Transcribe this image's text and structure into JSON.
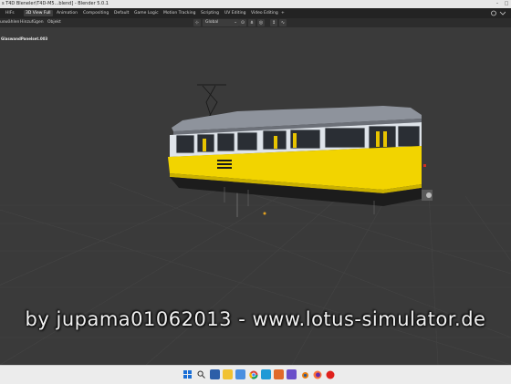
{
  "title_bar": {
    "title": "s T4D Bleneler\\T4D-M5...blend] - Blender 5.0.1",
    "window_controls": [
      "minimize-icon",
      "maximize-icon"
    ]
  },
  "workspace_tabs": [
    {
      "label": "HIFs",
      "active": false
    },
    {
      "label": "3D View Full",
      "active": true
    },
    {
      "label": "Animation",
      "active": false
    },
    {
      "label": "Compositing",
      "active": false
    },
    {
      "label": "Default",
      "active": false
    },
    {
      "label": "Game Logic",
      "active": false
    },
    {
      "label": "Motion Tracking",
      "active": false
    },
    {
      "label": "Scripting",
      "active": false
    },
    {
      "label": "UV Editing",
      "active": false
    },
    {
      "label": "Video Editing",
      "active": false
    },
    {
      "label": "+",
      "active": false
    }
  ],
  "viewport_header": {
    "menus": [
      "uswählen",
      "Hinzufügen",
      "Objekt"
    ],
    "transform_orientation": "Global",
    "icons": [
      "snap-icon",
      "proportional-icon",
      "pivot-icon",
      "transform-icon",
      "overlay-icon"
    ]
  },
  "viewport": {
    "object_label": "GlaswandPanelset.003",
    "tram": {
      "body_color": "#f2d400",
      "roof_color": "#8e939c",
      "skirt_color": "#1c1c1c",
      "window_color": "#dfe4ea"
    }
  },
  "watermark": "by jupama01062013 - www.lotus-simulator.de",
  "taskbar": {
    "icons": [
      "windows-start-icon",
      "search-icon",
      "file-explorer-icon",
      "folder-icon",
      "photos-icon",
      "chrome-icon",
      "edge-icon",
      "store-icon",
      "app-icon",
      "blender-icon",
      "firefox-icon",
      "record-icon"
    ]
  }
}
